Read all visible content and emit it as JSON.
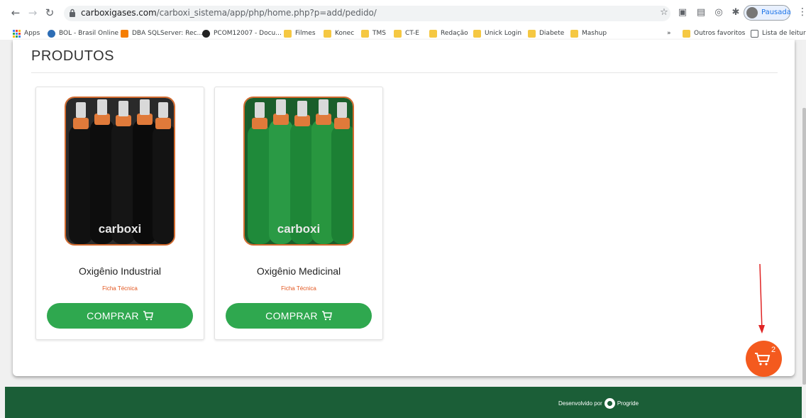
{
  "browser": {
    "url_host": "carboxigases.com",
    "url_path": "/carboxi_sistema/app/php/home.php?p=add/pedido/",
    "profile_label": "Pausada",
    "bookmarks": [
      {
        "label": "Apps",
        "icon": "apps-grid-icon"
      },
      {
        "label": "BOL - Brasil Online",
        "icon": "bol-icon"
      },
      {
        "label": "DBA SQLServer: Rec...",
        "icon": "blogger-icon"
      },
      {
        "label": "PCOM12007 - Docu...",
        "icon": "github-icon"
      },
      {
        "label": "Filmes",
        "icon": "folder-icon"
      },
      {
        "label": "Konec",
        "icon": "folder-icon"
      },
      {
        "label": "TMS",
        "icon": "folder-icon"
      },
      {
        "label": "CT-E",
        "icon": "folder-icon"
      },
      {
        "label": "Redação",
        "icon": "folder-icon"
      },
      {
        "label": "Unick Login",
        "icon": "folder-icon"
      },
      {
        "label": "Diabete",
        "icon": "folder-icon"
      },
      {
        "label": "Mashup",
        "icon": "folder-icon"
      }
    ],
    "overflow_label": "»",
    "other_bookmarks": "Outros favoritos",
    "reading_list": "Lista de leitura"
  },
  "page": {
    "heading": "PRODUTOS",
    "products": [
      {
        "name": "Oxigênio Industrial",
        "ficha": "Ficha Técnica",
        "button": "COMPRAR",
        "body_color": "#111111",
        "brand": "carboxi"
      },
      {
        "name": "Oxigênio Medicinal",
        "ficha": "Ficha Técnica",
        "button": "COMPRAR",
        "body_color": "#1f8a3a",
        "brand": "carboxi"
      }
    ],
    "cart_count": "2",
    "footer_prefix": "Desenvolvido por",
    "footer_brand": "Progride"
  },
  "colors": {
    "accent_green": "#2fa84f",
    "cart_orange": "#f45a1e",
    "footer_green": "#1b5e37",
    "ficha_red": "#e2561f"
  }
}
